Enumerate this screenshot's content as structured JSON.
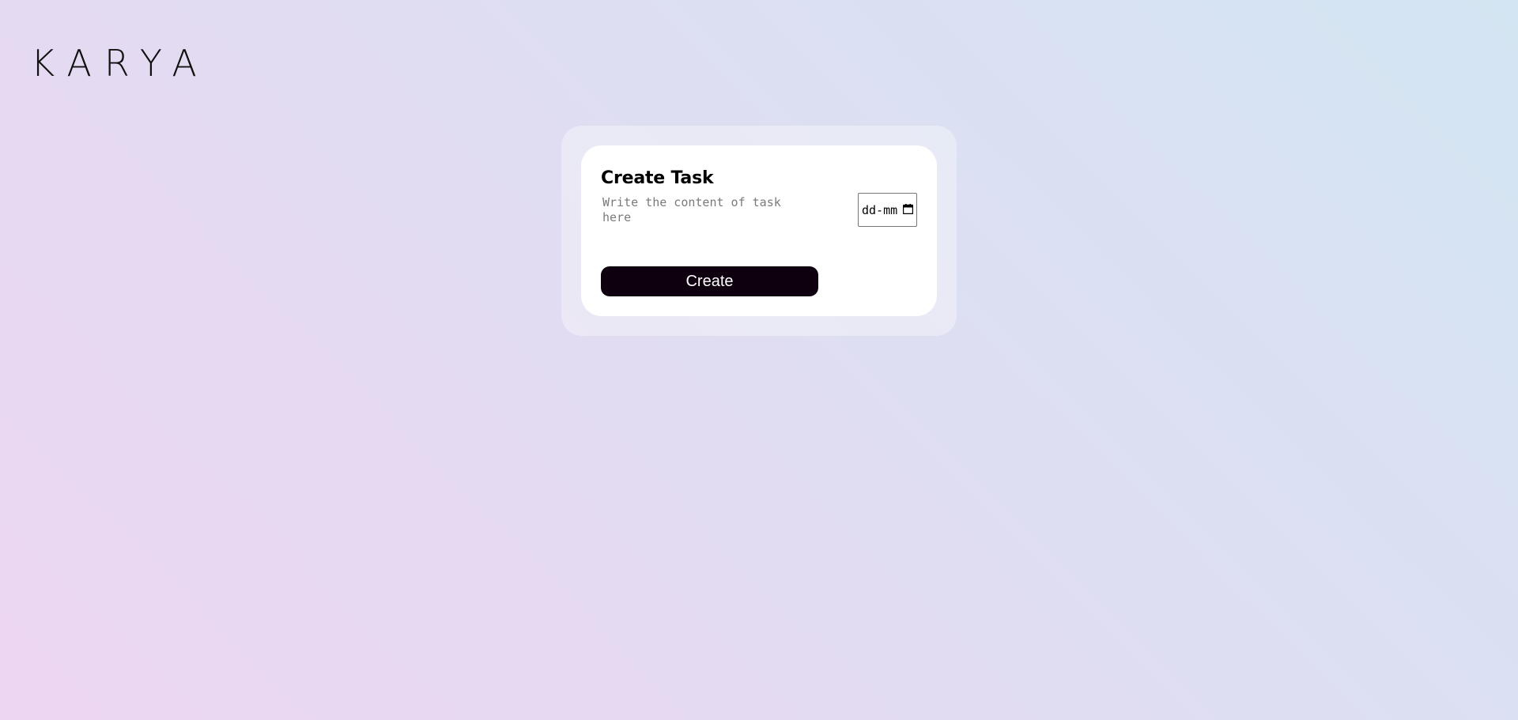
{
  "app": {
    "brand": "KARYA"
  },
  "form": {
    "title": "Create Task",
    "content_placeholder": "Write the content of task here",
    "content_value": "",
    "date_display": "dd-mm",
    "date_icon": "calendar-icon",
    "create_label": "Create"
  },
  "colors": {
    "button_background": "#0f0010",
    "card_background": "#ffffff"
  }
}
